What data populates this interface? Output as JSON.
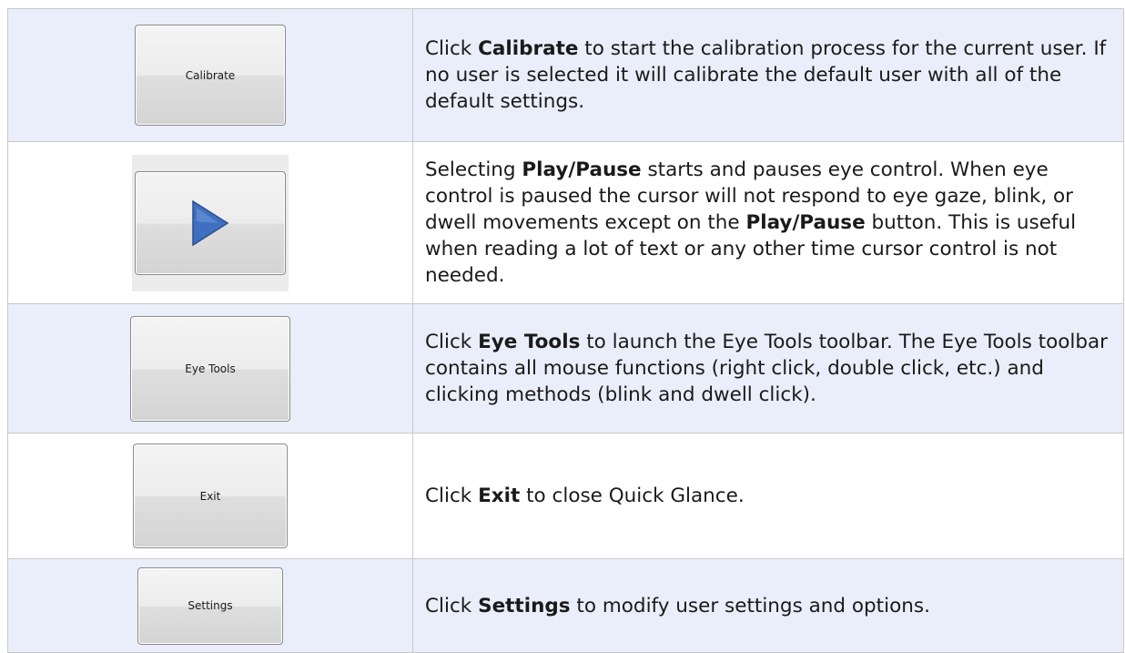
{
  "rows": [
    {
      "button_label": "Calibrate",
      "pre": "Click ",
      "kw": "Calibrate",
      "post": " to start the calibration process for the current user.  If no user is selected it will calibrate the default user with all of the default settings."
    },
    {
      "button_icon": "play-icon",
      "pre": "Selecting ",
      "kw": "Play/Pause",
      "mid": " starts and pauses eye control.  When eye control is paused the cursor will not respond to eye gaze, blink, or dwell movements except on the ",
      "kw2": "Play/Pause",
      "post": " button.  This is useful when reading a lot of text or any other time cursor control is not needed."
    },
    {
      "button_label": "Eye Tools",
      "pre": "Click ",
      "kw": "Eye Tools",
      "post": " to launch the Eye Tools toolbar.  The Eye Tools toolbar contains all mouse functions (right click, double click, etc.) and clicking methods (blink and dwell click)."
    },
    {
      "button_label": "Exit",
      "pre": "Click ",
      "kw": "Exit",
      "post": " to close Quick Glance."
    },
    {
      "button_label": "Settings",
      "pre": "Click ",
      "kw": "Settings",
      "post": " to modify user settings and options."
    }
  ],
  "colors": {
    "row_shade": "#eaeefa",
    "play_triangle": "#3f6fc0",
    "border": "#c9c9c9"
  }
}
